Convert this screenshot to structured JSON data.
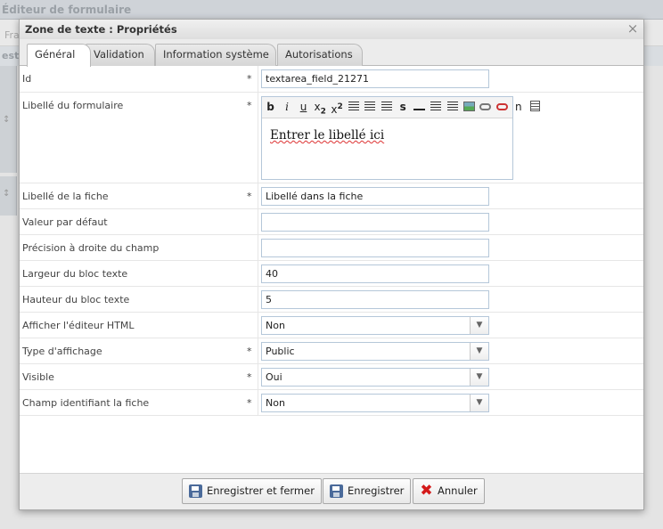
{
  "background": {
    "title": "Éditeur de formulaire",
    "row1_text": "Fra",
    "row2_text": "est"
  },
  "dialog": {
    "title": "Zone de texte : Propriétés",
    "close_icon": "close-icon"
  },
  "tabs": [
    {
      "label": "Général",
      "active": true
    },
    {
      "label": "Validation",
      "active": false
    },
    {
      "label": "Information système",
      "active": false
    },
    {
      "label": "Autorisations",
      "active": false
    }
  ],
  "fields": {
    "id": {
      "label": "Id",
      "required": "*",
      "value": "textarea_field_21271"
    },
    "form_label": {
      "label": "Libellé du formulaire",
      "required": "*",
      "editor_text": "Entrer le libellé ici"
    },
    "sheet_label": {
      "label": "Libellé de la fiche",
      "required": "*",
      "value": "Libellé dans la fiche"
    },
    "default_value": {
      "label": "Valeur par défaut",
      "value": ""
    },
    "right_precision": {
      "label": "Précision à droite du champ",
      "value": ""
    },
    "block_width": {
      "label": "Largeur du bloc texte",
      "value": "40"
    },
    "block_height": {
      "label": "Hauteur du bloc texte",
      "value": "5"
    },
    "html_editor": {
      "label": "Afficher l'éditeur HTML",
      "value": "Non"
    },
    "display_type": {
      "label": "Type d'affichage",
      "required": "*",
      "value": "Public"
    },
    "visible": {
      "label": "Visible",
      "required": "*",
      "value": "Oui"
    },
    "identifying_field": {
      "label": "Champ identifiant la fiche",
      "required": "*",
      "value": "Non"
    }
  },
  "toolbar": {
    "bold": "b",
    "italic": "i",
    "underline": "u",
    "subscript": "x",
    "sub": "2",
    "superscript": "x",
    "sup": "2",
    "strike": "s",
    "nbsp": "n"
  },
  "footer": {
    "save_close_label": "Enregistrer et fermer",
    "save_label": "Enregistrer",
    "cancel_label": "Annuler"
  },
  "colors": {
    "accent_border": "#b5c7d9",
    "cancel_icon": "#d41a1a"
  }
}
